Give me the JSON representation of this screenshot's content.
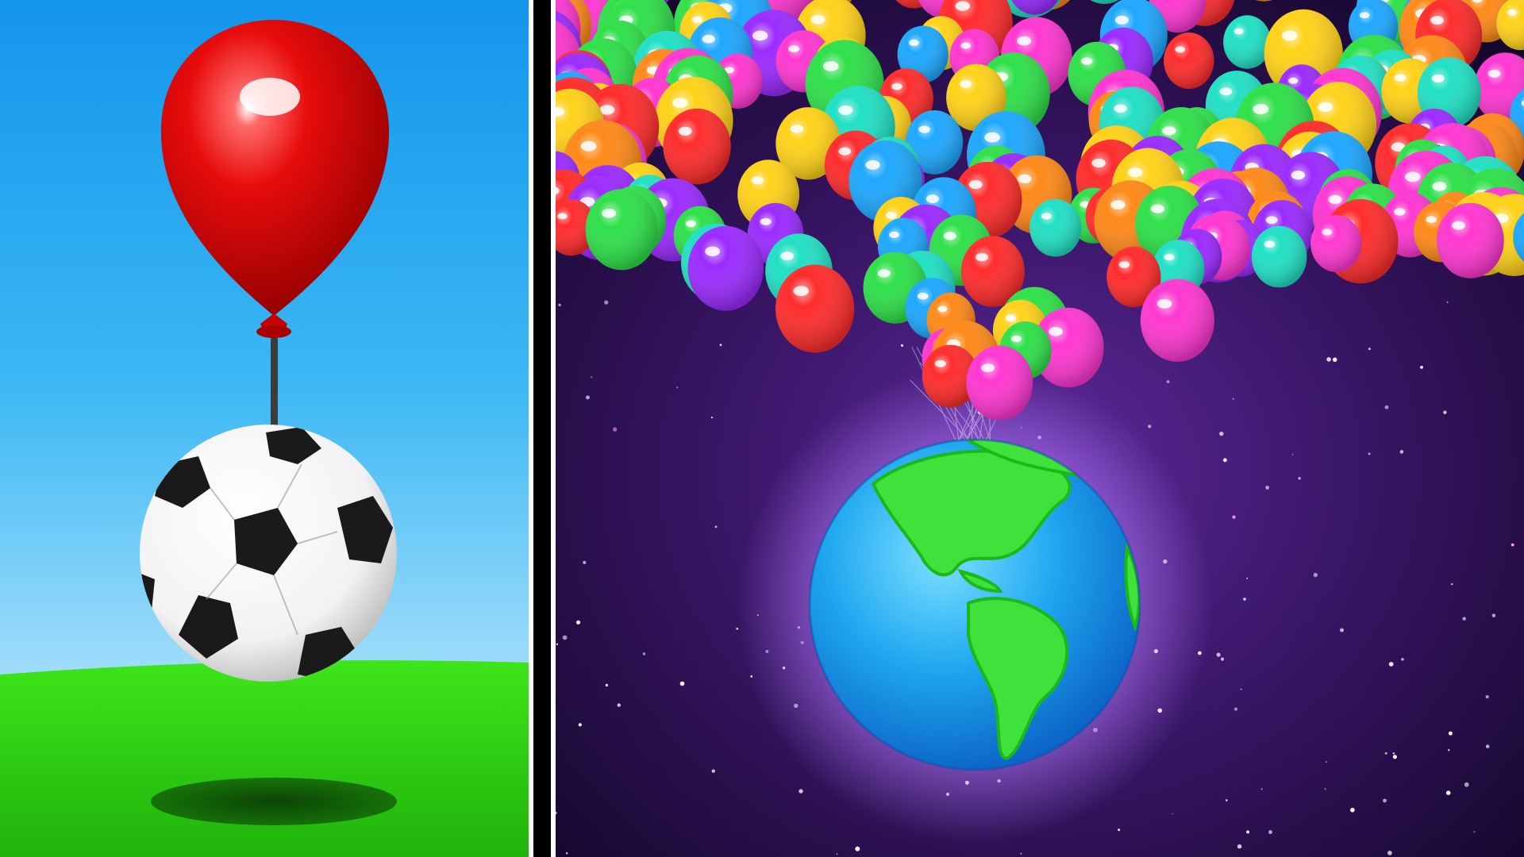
{
  "image": {
    "kind": "split-comparison-thumbnail",
    "left_scene": {
      "subject": "soccer-ball",
      "lifted_by": "single-red-balloon",
      "sky_top_color": "#1fa6ee",
      "sky_bottom_color": "#d7f2ff",
      "grass_color": "#2fd413",
      "balloon_color": "#e60d0d"
    },
    "right_scene": {
      "subject": "earth-globe",
      "lifted_by": "cluster-of-multicolor-balloons",
      "space_color": "#2a0f4a",
      "balloon_colors": [
        "#ff2d2d",
        "#ffd21a",
        "#30e04a",
        "#1fa8ff",
        "#9b2cff",
        "#ff38d2",
        "#ff8a1a",
        "#22e0c4"
      ]
    }
  }
}
